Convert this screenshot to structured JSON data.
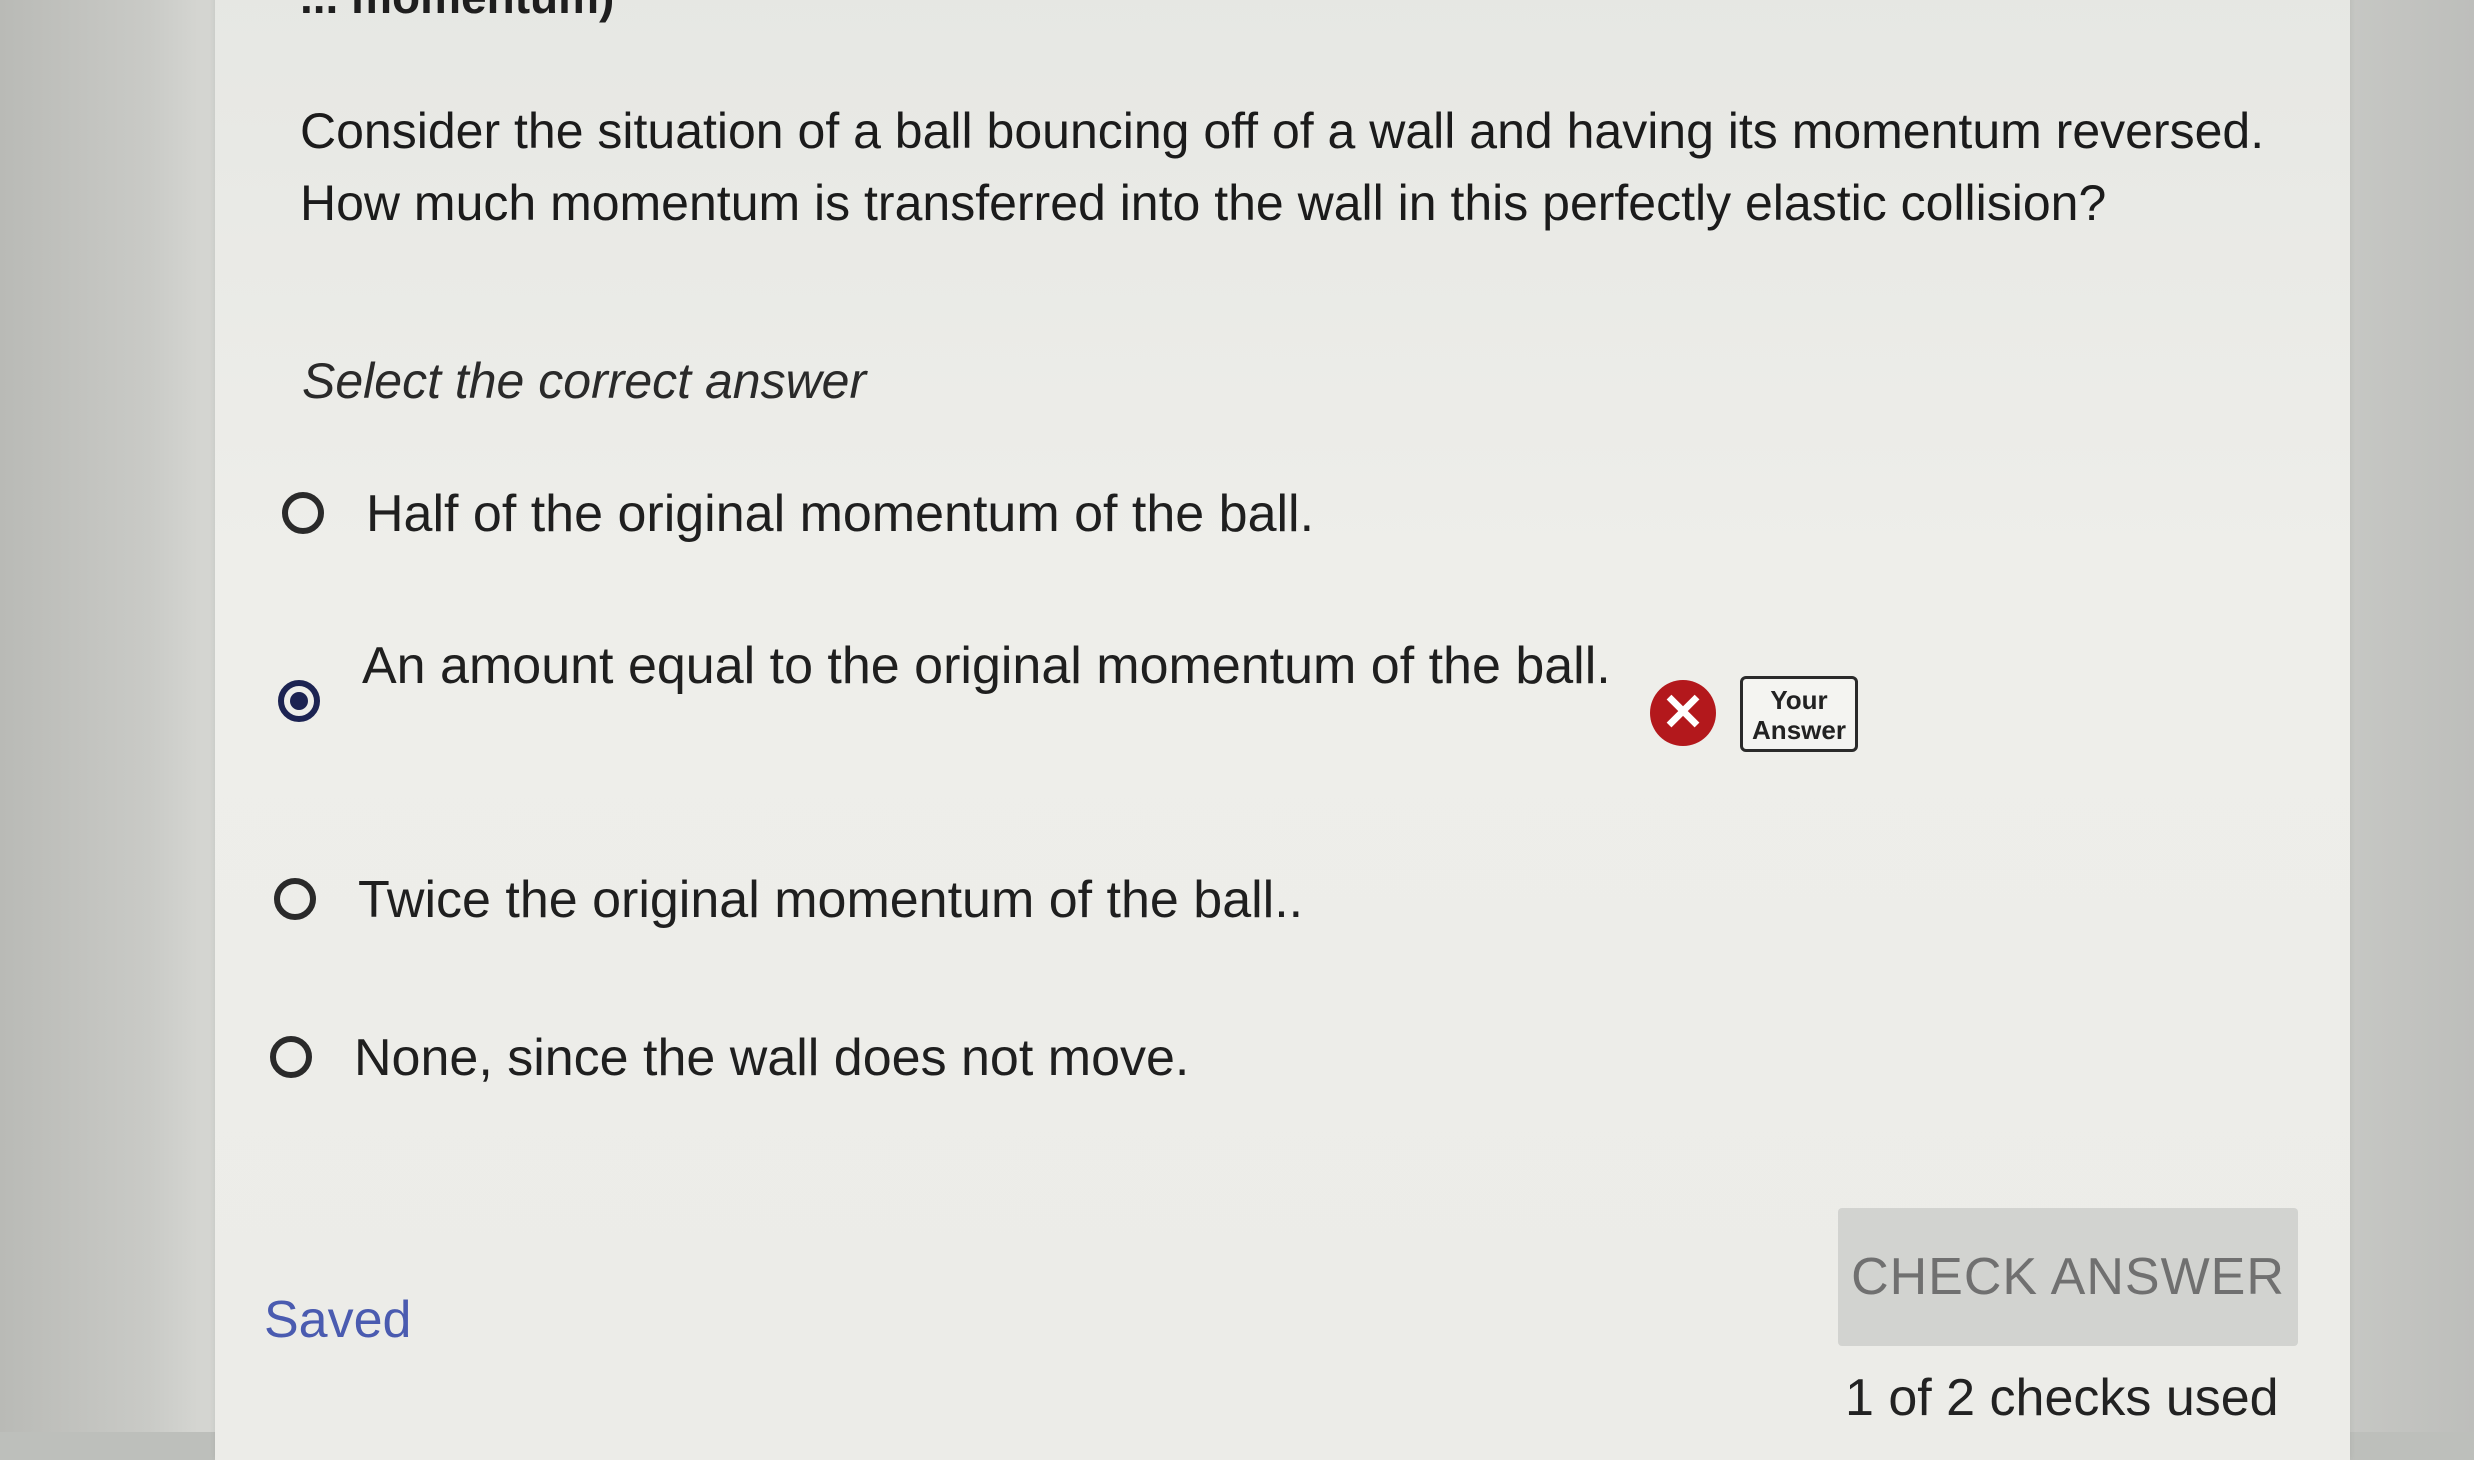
{
  "header": {
    "title_fragment": "... momentum)"
  },
  "question": {
    "text": "Consider the situation of a ball bouncing off of a wall and having its momentum reversed. How much momentum is transferred into the wall in this perfectly elastic collision?",
    "prompt": "Select the correct answer"
  },
  "options": [
    {
      "label": "Half of the original momentum of the ball.",
      "selected": false
    },
    {
      "label": "An amount equal to the original momentum of the ball.",
      "selected": true
    },
    {
      "label": "Twice the original momentum of the ball..",
      "selected": false
    },
    {
      "label": "None, since the wall does not move.",
      "selected": false
    }
  ],
  "feedback": {
    "wrong_icon": "close-icon",
    "wrong_symbol": "✕",
    "badge_line1": "Your",
    "badge_line2": "Answer",
    "wrong_color": "#b3181c"
  },
  "footer": {
    "saved_label": "Saved",
    "check_button_label": "CHECK ANSWER",
    "checks_used": "1 of 2 checks used",
    "saved_color": "#4a5bb0"
  }
}
